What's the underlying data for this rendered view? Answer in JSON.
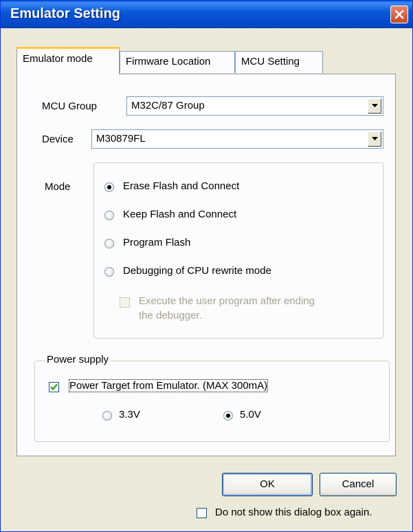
{
  "window": {
    "title": "Emulator Setting"
  },
  "tabs": [
    {
      "label": "Emulator mode"
    },
    {
      "label": "Firmware Location"
    },
    {
      "label": "MCU Setting"
    }
  ],
  "mcu_group": {
    "label": "MCU Group",
    "value": "M32C/87 Group"
  },
  "device": {
    "label": "Device",
    "value": "M30879FL"
  },
  "mode": {
    "label": "Mode",
    "options": [
      {
        "label": "Erase Flash and Connect",
        "selected": true
      },
      {
        "label": "Keep Flash and Connect",
        "selected": false
      },
      {
        "label": "Program Flash",
        "selected": false
      },
      {
        "label": "Debugging of CPU rewrite mode",
        "selected": false
      }
    ],
    "execute_after_end": {
      "line1": "Execute the user program after ending",
      "line2": "the debugger.",
      "checked": false,
      "enabled": false
    }
  },
  "power": {
    "group_label": "Power supply",
    "checkbox_label": "Power Target from Emulator. (MAX 300mA)",
    "checked": true,
    "voltages": [
      {
        "label": "3.3V",
        "selected": false
      },
      {
        "label": "5.0V",
        "selected": true
      }
    ]
  },
  "buttons": {
    "ok": "OK",
    "cancel": "Cancel"
  },
  "dont_show": {
    "label": "Do not show this dialog box again.",
    "checked": false
  }
}
